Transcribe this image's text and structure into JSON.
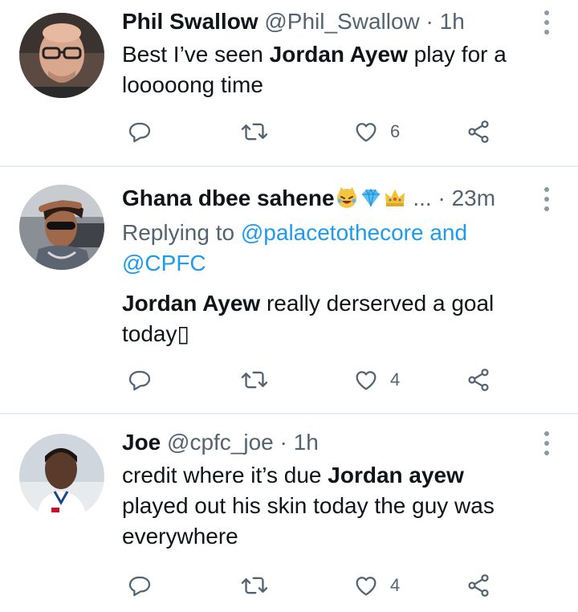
{
  "tweets": [
    {
      "name": "Phil Swallow",
      "handle": "@Phil_Swallow",
      "separator": "·",
      "time": "1h",
      "text_lines": [
        {
          "pre": "Best I’ve seen ",
          "bold": "Jordan Ayew",
          "post": " play for a"
        },
        {
          "pre": "looooong time",
          "bold": "",
          "post": ""
        }
      ],
      "reply_count": "",
      "retweet_count": "",
      "like_count": "6"
    },
    {
      "name": "Ghana dbee sahene",
      "name_suffix": "...",
      "emojis": [
        "laughing-cat-emoji",
        "diamond-emoji",
        "crown-emoji"
      ],
      "separator": "·",
      "time": "23m",
      "replying_prefix": "Replying to ",
      "replying_to_1": "@palacetothecore",
      "replying_and": " and",
      "replying_to_2": "@CPFC",
      "text_lines": [
        {
          "pre": "",
          "bold": "Jordan Ayew",
          "post": " really derserved a goal"
        },
        {
          "pre": "today",
          "bold": "",
          "post": "▯"
        }
      ],
      "like_count": "4"
    },
    {
      "name": "Joe",
      "handle": "@cpfc_joe",
      "separator": "·",
      "time": "1h",
      "text_lines": [
        {
          "pre": "credit where it’s due ",
          "bold": "Jordan ayew",
          "post": ""
        },
        {
          "pre": "played out his skin today the guy was",
          "bold": "",
          "post": ""
        },
        {
          "pre": "everywhere",
          "bold": "",
          "post": ""
        }
      ],
      "like_count": "4"
    }
  ],
  "colors": {
    "text": "#0f1419",
    "secondary": "#536471",
    "link": "#1d9bf0",
    "divider": "#e6ecf0"
  },
  "icons": [
    "reply-icon",
    "retweet-icon",
    "like-icon",
    "share-icon",
    "more-icon"
  ]
}
